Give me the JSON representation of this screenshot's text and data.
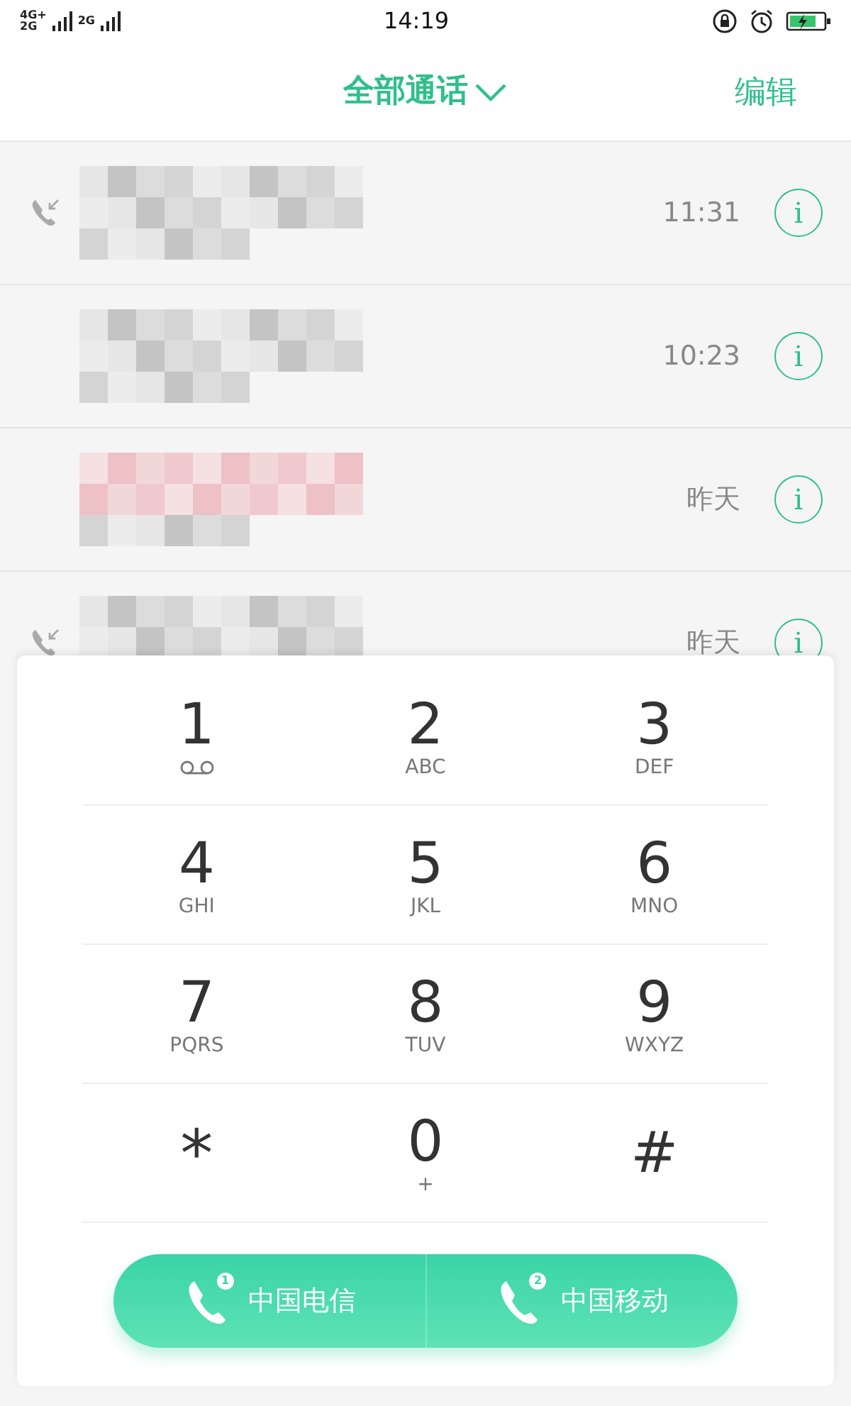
{
  "status_bar": {
    "network": [
      {
        "type": "4G+",
        "sub": "2G"
      },
      {
        "type": "2G"
      }
    ],
    "time": "14:19"
  },
  "header": {
    "title": "全部通话",
    "edit": "编辑"
  },
  "calls": [
    {
      "time": "11:31",
      "incoming": true,
      "missed": false,
      "info": "i"
    },
    {
      "time": "10:23",
      "incoming": false,
      "missed": false,
      "info": "i"
    },
    {
      "time": "昨天",
      "incoming": false,
      "missed": true,
      "info": "i"
    },
    {
      "time": "昨天",
      "incoming": true,
      "missed": false,
      "info": "i"
    }
  ],
  "keypad": [
    {
      "digit": "1",
      "kind": "voicemail"
    },
    {
      "digit": "2",
      "letters": "ABC"
    },
    {
      "digit": "3",
      "letters": "DEF"
    },
    {
      "digit": "4",
      "letters": "GHI"
    },
    {
      "digit": "5",
      "letters": "JKL"
    },
    {
      "digit": "6",
      "letters": "MNO"
    },
    {
      "digit": "7",
      "letters": "PQRS"
    },
    {
      "digit": "8",
      "letters": "TUV"
    },
    {
      "digit": "9",
      "letters": "WXYZ"
    },
    {
      "digit": "*"
    },
    {
      "digit": "0",
      "letters": "+"
    },
    {
      "digit": "#"
    }
  ],
  "call_buttons": [
    {
      "sim": "1",
      "label": "中国电信"
    },
    {
      "sim": "2",
      "label": "中国移动"
    }
  ]
}
